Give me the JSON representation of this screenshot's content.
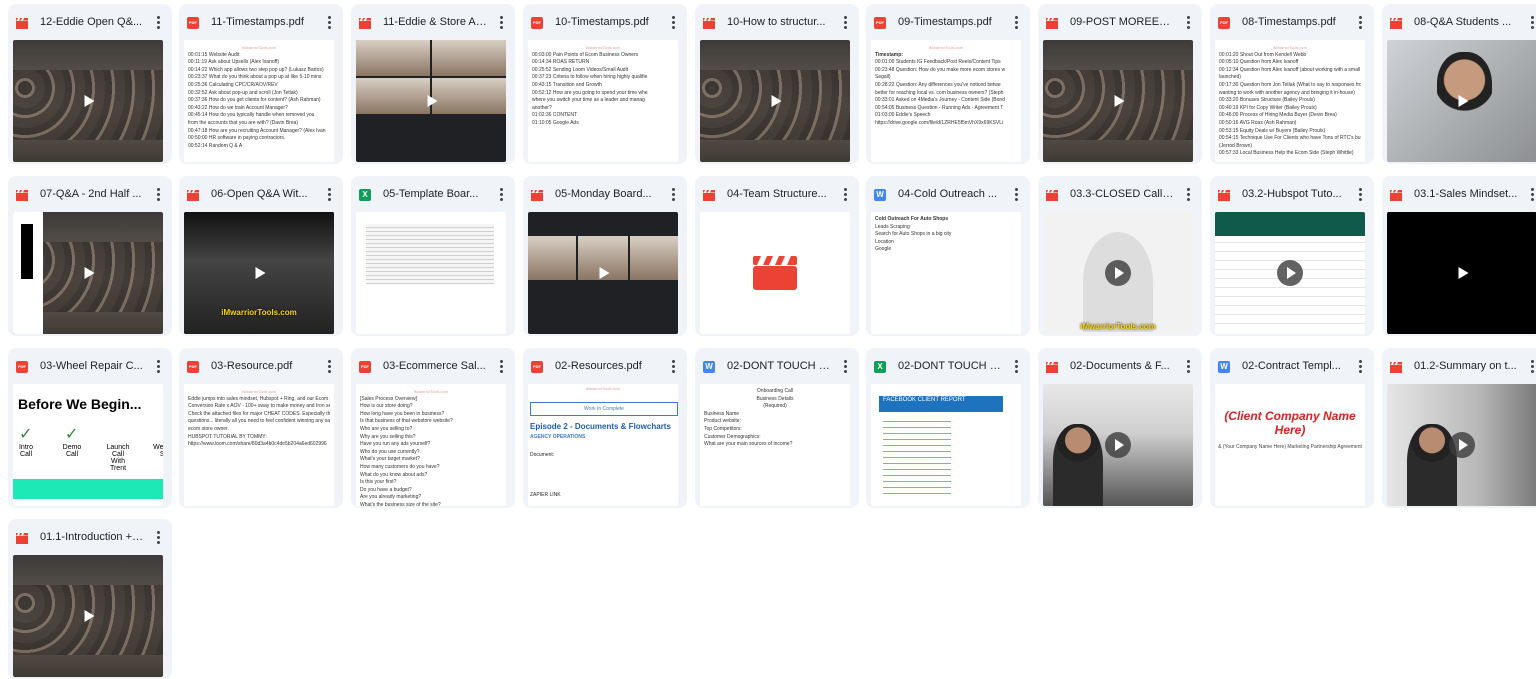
{
  "files": [
    {
      "title": "12-Eddie Open Q&...",
      "type": "video",
      "thumb": "photo"
    },
    {
      "title": "11-Timestamps.pdf",
      "type": "pdf",
      "thumb": "text1"
    },
    {
      "title": "11-Eddie & Store Au...",
      "type": "video",
      "thumb": "meet"
    },
    {
      "title": "10-Timestamps.pdf",
      "type": "pdf",
      "thumb": "text2"
    },
    {
      "title": "10-How to structur...",
      "type": "video",
      "thumb": "photo"
    },
    {
      "title": "09-Timestamps.pdf",
      "type": "pdf",
      "thumb": "text3"
    },
    {
      "title": "09-POST MOREEE...",
      "type": "video",
      "thumb": "photo"
    },
    {
      "title": "08-Timestamps.pdf",
      "type": "pdf",
      "thumb": "text4"
    },
    {
      "title": "08-Q&A Students ...",
      "type": "video",
      "thumb": "face"
    },
    {
      "title": "07-Q&A - 2nd Half ...",
      "type": "video",
      "thumb": "photo-dark"
    },
    {
      "title": "06-Open Q&A Wit...",
      "type": "video",
      "thumb": "dark-wm"
    },
    {
      "title": "05-Template Boar...",
      "type": "sheet",
      "thumb": "sheetgrid"
    },
    {
      "title": "05-Monday Board...",
      "type": "video",
      "thumb": "meet2"
    },
    {
      "title": "04-Team Structure...",
      "type": "video",
      "thumb": "clapper"
    },
    {
      "title": "04-Cold Outreach ...",
      "type": "doc",
      "thumb": "cold"
    },
    {
      "title": "03.3-CLOSED Call ...",
      "type": "video",
      "thumb": "grey"
    },
    {
      "title": "03.2-Hubspot Tuto...",
      "type": "video",
      "thumb": "hubspot"
    },
    {
      "title": "03.1-Sales Mindset...",
      "type": "video",
      "thumb": "dark"
    },
    {
      "title": "03-Wheel Repair C...",
      "type": "pdf",
      "thumb": "slide"
    },
    {
      "title": "03-Resource.pdf",
      "type": "pdf",
      "thumb": "text5"
    },
    {
      "title": "03-Ecommerce Sal...",
      "type": "pdf",
      "thumb": "text6"
    },
    {
      "title": "02-Resources.pdf",
      "type": "pdf",
      "thumb": "episode"
    },
    {
      "title": "02-DONT TOUCH -...",
      "type": "doc",
      "thumb": "onboard"
    },
    {
      "title": "02-DONT TOUCH -...",
      "type": "sheet",
      "thumb": "fb"
    },
    {
      "title": "02-Documents & F...",
      "type": "video",
      "thumb": "person"
    },
    {
      "title": "02-Contract Templ...",
      "type": "doc",
      "thumb": "contract"
    },
    {
      "title": "01.2-Summary on t...",
      "type": "video",
      "thumb": "person2"
    },
    {
      "title": "01.1-Introduction + ...",
      "type": "video",
      "thumb": "photo"
    }
  ],
  "type_labels": {
    "pdf": "PDF",
    "doc": "W",
    "sheet": "X"
  },
  "watermark": "iMwarriorTools.com",
  "thumb_text": {
    "text1": [
      "00:01:15 Website Audit",
      "00:11:19 Ask about Upsells (Alex Ivanoff)",
      "00:14:22 Which app allows two step pop up? (Lukasz Bartos)",
      "00:23:37 What do you think about a pop up at like 5-10 mins",
      "00:25:36 Calculating CPC/CR/AOV/REV",
      "00:32:52 Ask about pop-up and scroll (Jon Tetlak)",
      "00:37:36 How do you get clients for content? (Ash Rahman)",
      "00:43:22 How do we train Account Manager?",
      "00:45:14 How do you typically handle when removed you",
      "from the accounts that you are with? (Davin Brea)",
      "00:47:18 How are you recruiting Account Manager? (Alex Ivan",
      "00:50:00 HR software in paying contractors.",
      "00:52:14 Random Q & A"
    ],
    "text2": [
      "00:03:00 Pain Points of Ecom Business Owners",
      "00:14:34 ROAS RETURN",
      "00:25:52 Sending Loom Videos/Small Audit",
      "00:37:23 Criteria to follow when hiring highly qualifie",
      "00:43:15 Transition and Growth",
      "00:52:12 How are you going to spend your time whe",
      "where you switch your time as a leader and manag",
      "another?",
      "01:02:36 CONTENT",
      "01:10:05 Google Ads"
    ],
    "text3": [
      "Timestamp:",
      "00:01:00 Students IG Feedback/Post Reels/Content Tips",
      "00:23:48 Question: How do you make more ecom stores w",
      "Segall)",
      "00:28:22 Question: Any differences you've noticed betwe",
      "better for reaching local vs. com business owners? (Steph",
      "00:33:01 Asked on 4Media's Journey - Content Side (Bond",
      "00:54:05 Business Question - Running Ads - Agreement T",
      "01:03:00 Eddie's Speech",
      "https://drive.google.com/file/d/1ZRHE5f5mVhX9x69KSVLi"
    ],
    "text4": [
      "00:01:20 Shout Out from Kendell Webb",
      "00:05:10 Question from Alex Ivanoff",
      "00:12:34 Question from Alex Ivanoff (about working with a small br",
      "launched)",
      "00:17:30 Question from Jon Tetlak (What to say to responses from p",
      "wanting to work with another agency and bringing it in-house)",
      "00:33:20 Bonuses Structure (Bailey Proulx)",
      "00:40:19 KPI for Copy Writer (Bailey Proulx)",
      "00:46:00 Process of Hiring Media Buyer (Devin Brea)",
      "00:50:16 AVG Roas (Ash Rahman)",
      "00:53:15 Equity Deals w/ Buyers (Bailey Proulx)",
      "00:54:15 Technique Use For Clients who have Tons of RTC's but Low",
      "(Jerrod Brown)",
      "00:57:33 Local Business Help the Ecom Side (Steph Whittle)"
    ],
    "text5": [
      "Eddie jumps into sales mindset, Hubspot + Ring, and our Ecom qualifying",
      "",
      "Conversion Rate x AOV - 100+ sway to make money and Iron sells",
      "",
      "Check the attached files for major CHEAT CODES. Especially those SALES",
      "questions... literally all you need to feel confident winning any sales (*an",
      "ecom store owner.",
      "",
      "HUBSPOT TUTORIAL BY TOMMY:",
      "https://www.loom.com/share/80d3a4b0c4de5b204a6ed602996"
    ],
    "text6": [
      "[Sales Process Overview]",
      "How is our store doing?",
      "How long have you been in business?",
      "Is that business of that webstore website?",
      "Who are you selling to?",
      "Why are you selling this?",
      "Have you run any ads yourself?",
      "Who do you use currently?",
      "What's your target market?",
      "How many customers do you have?",
      "What do you know about ads?",
      "Is this your first?",
      "Do you have a budget?",
      "Are you already marketing?",
      "What's the business size of the site?"
    ],
    "cold": [
      "Cold Outreach For Auto Shops",
      "Leads Scraping",
      "Search for Auto Shops in a big city",
      "Location",
      "Google"
    ],
    "onboard": [
      "Onboarding Call",
      "Business Details",
      "(Required)",
      "Business Name",
      "Product website:",
      "Top Competitors:",
      "Customer Demographics:",
      "What are your main sources of income?"
    ],
    "episode": [
      "Work In Complete",
      "Episode 2 - Documents & Flowcharts",
      "AGENCY OPERATIONS",
      "Document:",
      "ZAPIER LINK"
    ],
    "slide": {
      "title": "Before We Begin...",
      "steps": [
        "Intro Call",
        "Demo Call",
        "Launch Call With Trent",
        "We Ou Sy"
      ]
    },
    "fb": "FACEBOOK CLIENT REPORT",
    "contract": {
      "title": "(Client Company Name Here)",
      "sub": "& (Your Company Name Here) Marketing Partnership Agreement"
    }
  }
}
